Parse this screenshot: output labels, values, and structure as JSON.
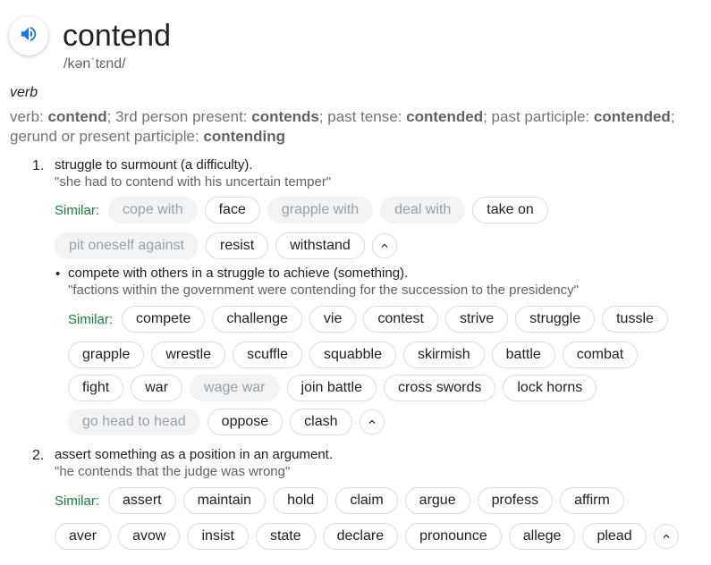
{
  "header": {
    "word": "contend",
    "phonetic": "/kənˈtɛnd/"
  },
  "part_of_speech": "verb",
  "forms": {
    "verb_label": "verb: ",
    "verb": "contend",
    "p3_label": "; 3rd person present: ",
    "p3": "contends",
    "past_label": "; past tense: ",
    "past": "contended",
    "pp_label": "; past participle: ",
    "pp": "contended",
    "ger_label": ";",
    "ger_label2": "gerund or present participle: ",
    "ger": "contending"
  },
  "similar_label": "Similar:",
  "sense1": {
    "number": "1.",
    "definition": "struggle to surmount (a difficulty).",
    "example": "\"she had to contend with his uncertain temper\"",
    "row1": [
      "cope with",
      "face",
      "grapple with",
      "deal with",
      "take on"
    ],
    "row2": [
      "pit oneself against",
      "resist",
      "withstand"
    ]
  },
  "sub": {
    "bullet": "•",
    "definition": "compete with others in a struggle to achieve (something).",
    "example": "\"factions within the government were contending for the succession to the presidency\"",
    "row1": [
      "compete",
      "challenge",
      "vie",
      "contest",
      "strive",
      "struggle",
      "tussle"
    ],
    "row2": [
      "grapple",
      "wrestle",
      "scuffle",
      "squabble",
      "skirmish",
      "battle",
      "combat"
    ],
    "row3": [
      "fight",
      "war",
      "wage war",
      "join battle",
      "cross swords",
      "lock horns"
    ],
    "row4": [
      "go head to head",
      "oppose",
      "clash"
    ]
  },
  "sense2": {
    "number": "2.",
    "definition": "assert something as a position in an argument.",
    "example": "\"he contends that the judge was wrong\"",
    "row1": [
      "assert",
      "maintain",
      "hold",
      "claim",
      "argue",
      "profess",
      "affirm"
    ],
    "row2": [
      "aver",
      "avow",
      "insist",
      "state",
      "declare",
      "pronounce",
      "allege",
      "plead"
    ]
  },
  "icons": {
    "speaker": "speaker-icon",
    "chevron": "chevron-up-icon"
  },
  "colors": {
    "accent": "#1a73e8",
    "similar": "#188038",
    "muted": "#70757a"
  }
}
